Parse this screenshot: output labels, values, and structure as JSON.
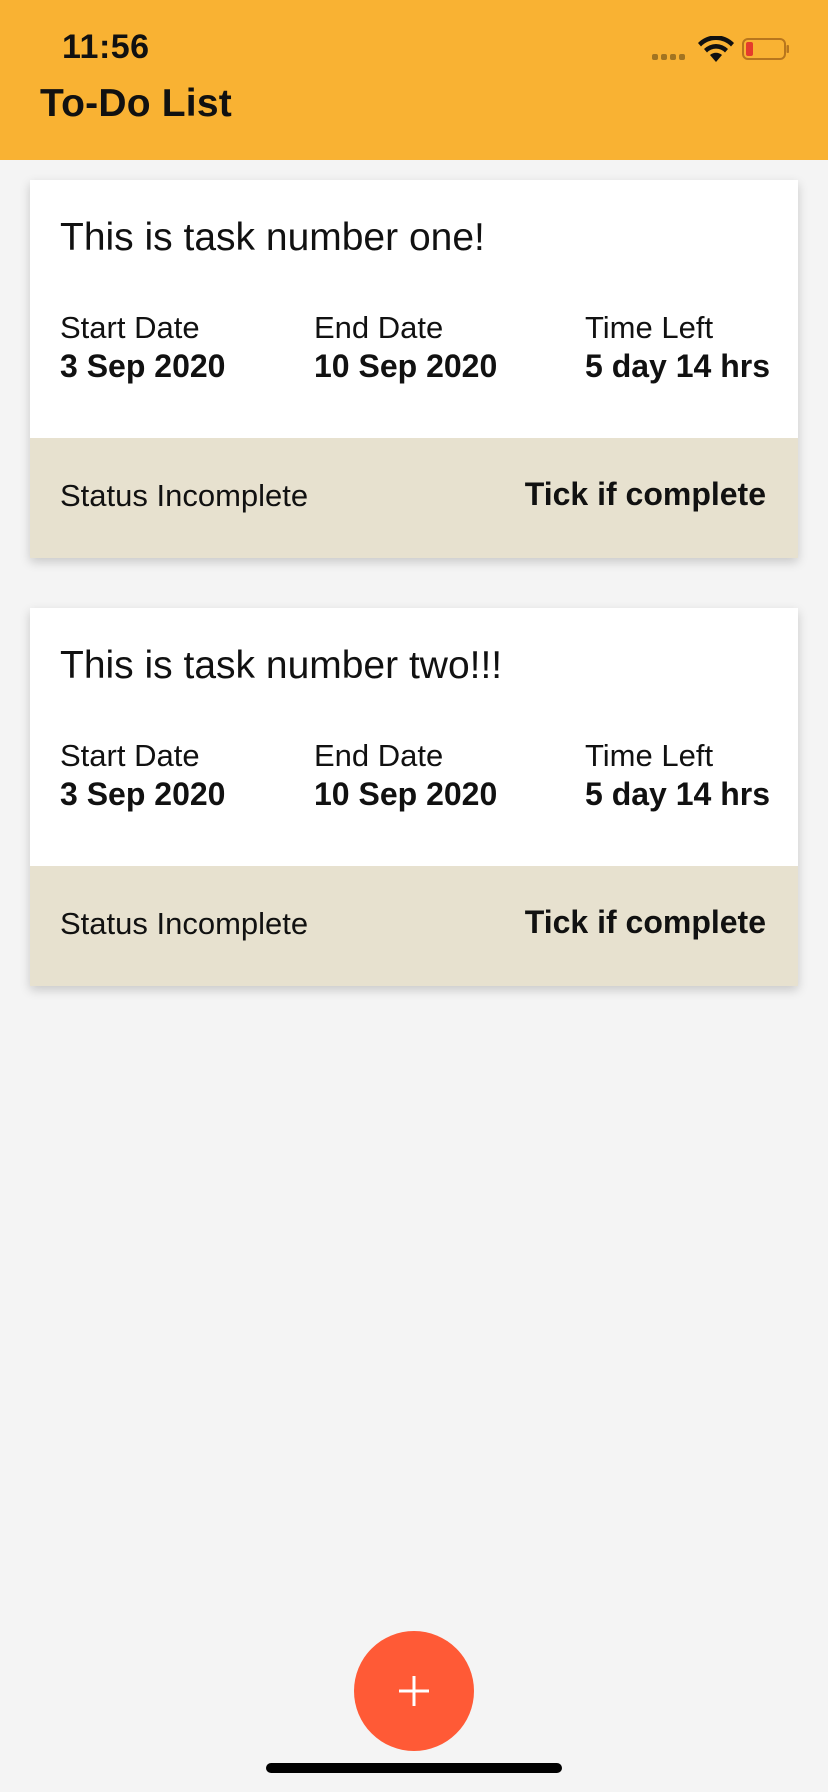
{
  "status_bar": {
    "time": "11:56",
    "icons": [
      "signal-dots-icon",
      "wifi-icon",
      "battery-low-icon"
    ],
    "battery_color": "#e53b2c"
  },
  "header": {
    "title": "To-Do List",
    "background": "#f9b233"
  },
  "tasks": [
    {
      "title": "This is task number one!",
      "start_label": "Start Date",
      "start_value": "3 Sep 2020",
      "end_label": "End Date",
      "end_value": "10 Sep 2020",
      "time_label": "Time Left",
      "time_value": "5 day 14 hrs",
      "status": "Status Incomplete",
      "action": "Tick if complete"
    },
    {
      "title": "This is task number two!!!",
      "start_label": "Start Date",
      "start_value": "3 Sep 2020",
      "end_label": "End Date",
      "end_value": "10 Sep 2020",
      "time_label": "Time Left",
      "time_value": "5 day 14 hrs",
      "status": "Status Incomplete",
      "action": "Tick if complete"
    }
  ],
  "fab": {
    "icon": "plus-icon",
    "color": "#ff5a36"
  },
  "colors": {
    "card_footer": "#e7e1cf",
    "background": "#f4f4f4"
  }
}
